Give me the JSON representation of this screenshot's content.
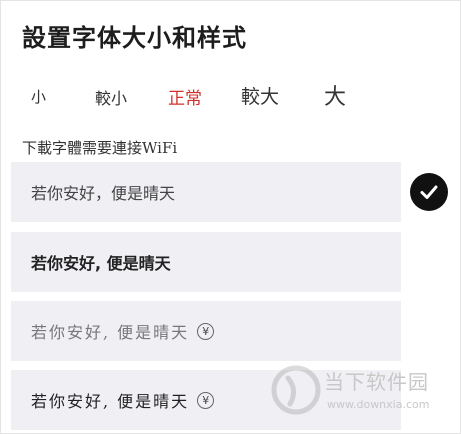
{
  "header": {
    "title": "設置字体大小和样式"
  },
  "size_options": [
    {
      "label": "小",
      "selected": false
    },
    {
      "label": "較小",
      "selected": false
    },
    {
      "label": "正常",
      "selected": true
    },
    {
      "label": "較大",
      "selected": false
    },
    {
      "label": "大",
      "selected": false
    }
  ],
  "colors": {
    "accent": "#d0312d",
    "row_bg": "#f0eff4",
    "check_bg": "#111111"
  },
  "note": "下載字體需要連接WiFi",
  "font_styles": [
    {
      "sample": "若你安好，便是晴天",
      "selected": true,
      "paid": false
    },
    {
      "sample": "若你安好, 便是晴天",
      "selected": false,
      "paid": false
    },
    {
      "sample": "若你安好, 便是晴天",
      "selected": false,
      "paid": true,
      "price_icon": "¥"
    },
    {
      "sample": "若你安好, 便是晴天",
      "selected": false,
      "paid": true,
      "price_icon": "¥"
    }
  ],
  "watermark": {
    "text": "当下软件园",
    "url": "www.downxia.com"
  }
}
